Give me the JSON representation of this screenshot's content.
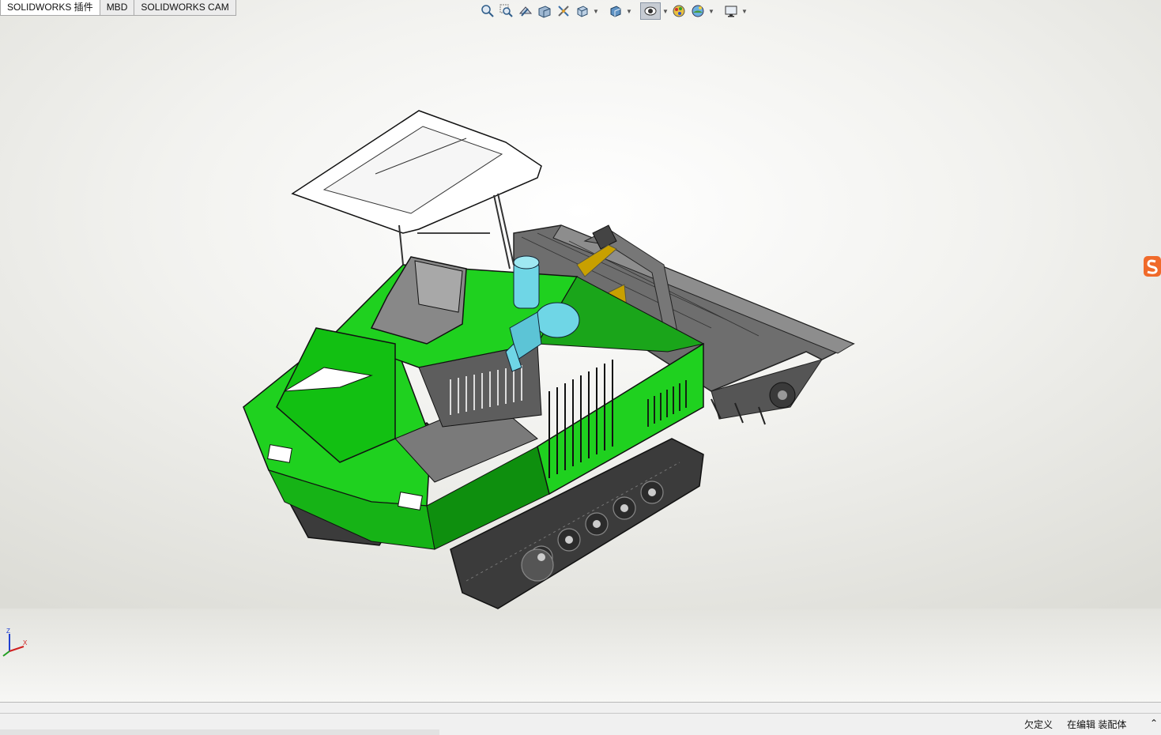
{
  "tabs": [
    {
      "label": "SOLIDWORKS 插件",
      "active": true
    },
    {
      "label": "MBD",
      "active": false
    },
    {
      "label": "SOLIDWORKS CAM",
      "active": false
    }
  ],
  "heads_up_toolbar": {
    "icons": [
      "zoom-to-fit-icon",
      "zoom-to-area-icon",
      "previous-view-icon",
      "section-view-icon",
      "dynamic-annotation-icon",
      "view-orientation-icon",
      "display-style-icon",
      "hide-show-items-icon",
      "edit-appearance-icon",
      "apply-scene-icon",
      "view-settings-icon"
    ]
  },
  "status": {
    "definition": "欠定义",
    "editing": "在编辑 装配体"
  },
  "colors": {
    "body_green": "#1fd11f",
    "dark_green": "#0e8f0e",
    "gray_metal": "#6e6e6e",
    "cyan_part": "#6fd6e6"
  }
}
